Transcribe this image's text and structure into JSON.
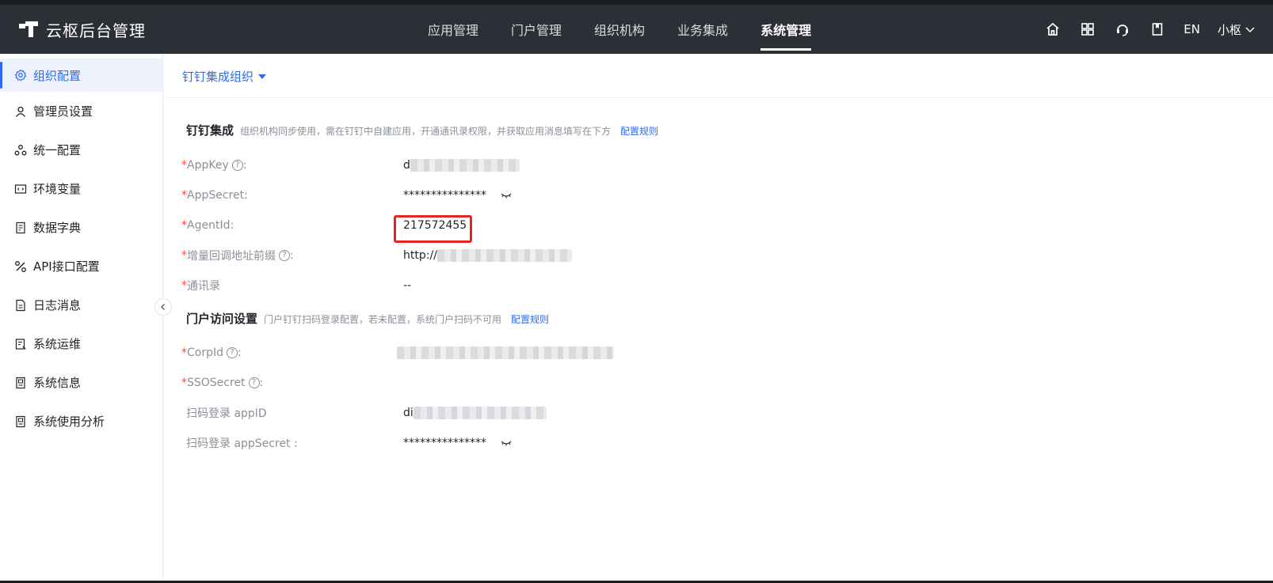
{
  "header": {
    "app_title": "云枢后台管理",
    "nav": [
      "应用管理",
      "门户管理",
      "组织机构",
      "业务集成",
      "系统管理"
    ],
    "active_nav": "系统管理",
    "lang": "EN",
    "user": "小枢"
  },
  "sidebar": {
    "items": [
      {
        "label": "组织配置",
        "icon": "gear-icon"
      },
      {
        "label": "管理员设置",
        "icon": "user-icon"
      },
      {
        "label": "统一配置",
        "icon": "cluster-icon"
      },
      {
        "label": "环境变量",
        "icon": "code-window-icon"
      },
      {
        "label": "数据字典",
        "icon": "book-icon"
      },
      {
        "label": "API接口配置",
        "icon": "api-icon"
      },
      {
        "label": "日志消息",
        "icon": "file-icon"
      },
      {
        "label": "系统运维",
        "icon": "tool-doc-icon"
      },
      {
        "label": "系统信息",
        "icon": "info-doc-icon"
      },
      {
        "label": "系统使用分析",
        "icon": "chart-doc-icon"
      }
    ],
    "active": "组织配置"
  },
  "subbar": {
    "select_label": "钉钉集成组织"
  },
  "section1": {
    "title": "钉钉集成",
    "desc": "组织机构同步使用，需在钉钉中自建应用，开通通讯录权限，并获取应用消息填写在下方",
    "link": "配置规则"
  },
  "section2": {
    "title": "门户访问设置",
    "desc": "门户钉钉扫码登录配置，若未配置，系统门户扫码不可用",
    "link": "配置规则"
  },
  "fields": {
    "appkey_label": "AppKey",
    "appkey_value": "d",
    "appsecret_label": "AppSecret:",
    "appsecret_value": "***************",
    "agentid_label": "AgentId:",
    "agentid_value": "217572455",
    "callback_label": "增量回调地址前缀",
    "callback_value": "http://",
    "contacts_label": "通讯录",
    "contacts_value": "--",
    "corpid_label": "CorpId",
    "ssosecret_label": "SSOSecret",
    "scan_appid_label": "扫码登录 appID",
    "scan_appid_value": "di",
    "scan_appsecret_label": "扫码登录 appSecret :",
    "scan_appsecret_value": "***************"
  },
  "colors": {
    "header_bg": "#2c2f35",
    "accent": "#2e6bf0",
    "required": "#f54a45",
    "highlight": "#e52521"
  }
}
